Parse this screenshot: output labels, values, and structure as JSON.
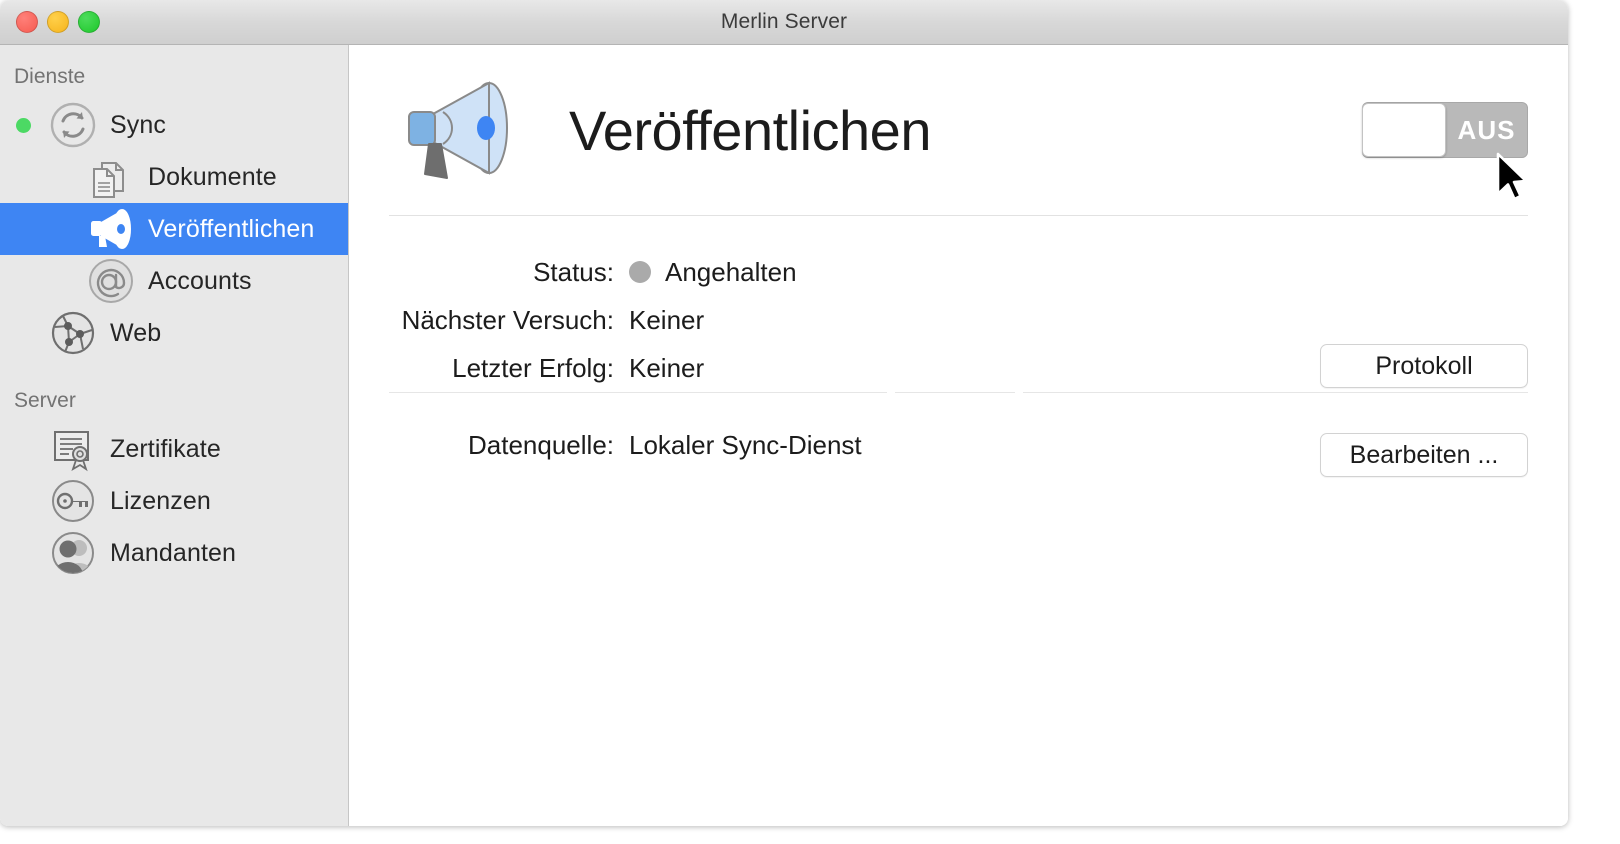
{
  "window": {
    "title": "Merlin Server",
    "traffic_lights": [
      "close-button",
      "minimize-button",
      "maximize-button"
    ]
  },
  "sidebar": {
    "sections": [
      {
        "header": "Dienste",
        "items": [
          {
            "label": "Sync",
            "icon": "sync-icon",
            "status_dot": "#4cd964",
            "indent": 0,
            "selected": false
          },
          {
            "label": "Dokumente",
            "icon": "documents-icon",
            "indent": 1,
            "selected": false
          },
          {
            "label": "Veröffentlichen",
            "icon": "megaphone-icon",
            "indent": 1,
            "selected": true
          },
          {
            "label": "Accounts",
            "icon": "at-sign-icon",
            "indent": 1,
            "selected": false
          },
          {
            "label": "Web",
            "icon": "network-globe-icon",
            "indent": 0,
            "selected": false
          }
        ]
      },
      {
        "header": "Server",
        "items": [
          {
            "label": "Zertifikate",
            "icon": "certificate-icon",
            "indent": 0,
            "selected": false
          },
          {
            "label": "Lizenzen",
            "icon": "key-icon",
            "indent": 0,
            "selected": false
          },
          {
            "label": "Mandanten",
            "icon": "people-icon",
            "indent": 0,
            "selected": false
          }
        ]
      }
    ]
  },
  "main": {
    "page_icon": "megaphone-icon",
    "page_title": "Veröffentlichen",
    "toggle": {
      "label": "AUS",
      "state": "off"
    },
    "status_rows": [
      {
        "label": "Status:",
        "value": "Angehalten",
        "dot": "#aaaaaa"
      },
      {
        "label": "Nächster Versuch:",
        "value": "Keiner"
      },
      {
        "label": "Letzter Erfolg:",
        "value": "Keiner"
      }
    ],
    "log_button": "Protokoll",
    "source_row": {
      "label": "Datenquelle:",
      "value": "Lokaler Sync-Dienst"
    },
    "edit_button": "Bearbeiten ..."
  },
  "colors": {
    "selection_blue": "#3e85f3",
    "sidebar_bg": "#e8e8e8",
    "toggle_track": "#b9b9b9",
    "status_green": "#4cd964",
    "status_gray": "#aaaaaa"
  }
}
